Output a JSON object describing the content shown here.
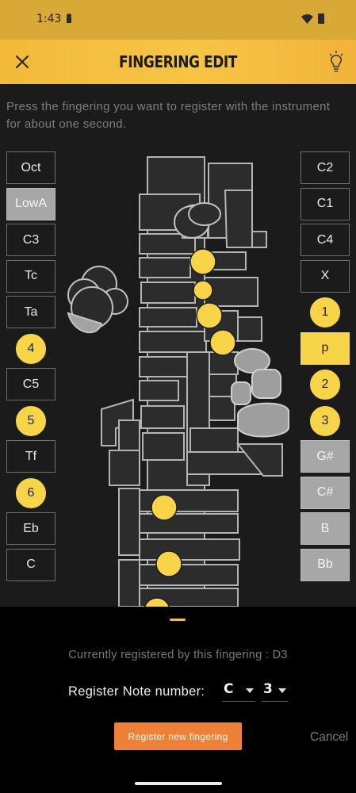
{
  "status_bar": {
    "time": "1:43"
  },
  "header": {
    "title": "FINGERING EDIT",
    "close_icon": "close-icon",
    "hint_icon": "lightbulb-icon"
  },
  "instruction": "Press the fingering you want to register with the instrument for about one second.",
  "left_keys": [
    {
      "label": "Oct",
      "state": "off"
    },
    {
      "label": "LowA",
      "state": "gray"
    },
    {
      "label": "C3",
      "state": "off"
    },
    {
      "label": "Tc",
      "state": "off"
    },
    {
      "label": "Ta",
      "state": "off"
    },
    {
      "label": "4",
      "state": "circle"
    },
    {
      "label": "C5",
      "state": "off"
    },
    {
      "label": "5",
      "state": "circle"
    },
    {
      "label": "Tf",
      "state": "off"
    },
    {
      "label": "6",
      "state": "circle"
    },
    {
      "label": "Eb",
      "state": "off"
    },
    {
      "label": "C",
      "state": "off"
    }
  ],
  "right_keys": [
    {
      "label": "C2",
      "state": "off"
    },
    {
      "label": "C1",
      "state": "off"
    },
    {
      "label": "C4",
      "state": "off"
    },
    {
      "label": "X",
      "state": "off"
    },
    {
      "label": "1",
      "state": "circle"
    },
    {
      "label": "p",
      "state": "yellow"
    },
    {
      "label": "2",
      "state": "circle"
    },
    {
      "label": "3",
      "state": "circle"
    },
    {
      "label": "G#",
      "state": "gray"
    },
    {
      "label": "C#",
      "state": "gray"
    },
    {
      "label": "B",
      "state": "gray"
    },
    {
      "label": "Bb",
      "state": "gray"
    }
  ],
  "bottom": {
    "current_registered": "Currently registered by this fingering : D3",
    "register_label": "Register Note number:",
    "note_select": "C",
    "octave_select": "3",
    "register_button": "Register new fingering",
    "cancel": "Cancel"
  },
  "colors": {
    "accent": "#f8d548",
    "header": "#f5bd3e",
    "button": "#ee8037"
  }
}
